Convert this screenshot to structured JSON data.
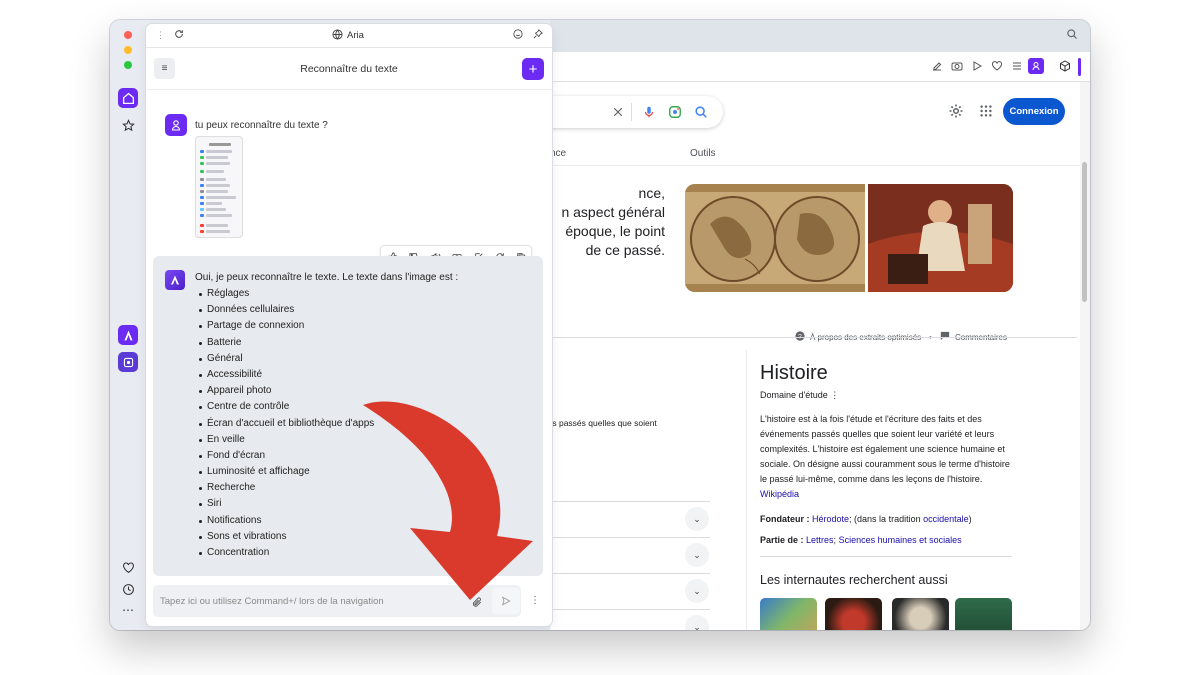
{
  "panel": {
    "top_title": "Aria",
    "header_title": "Reconnaître du texte",
    "user_message": "tu peux reconnaître du texte ?",
    "answer_intro": "Oui, je peux reconnaître le texte. Le texte dans l'image est :",
    "answer_items": [
      "Réglages",
      "Données cellulaires",
      "Partage de connexion",
      "Batterie",
      "Général",
      "Accessibilité",
      "Appareil photo",
      "Centre de contrôle",
      "Écran d'accueil et bibliothèque d'apps",
      "En veille",
      "Fond d'écran",
      "Luminosité et affichage",
      "Recherche",
      "Siri",
      "Notifications",
      "Sons et vibrations",
      "Concentration"
    ],
    "input_placeholder": "Tapez ici ou utilisez Command+/ lors de la navigation"
  },
  "web": {
    "connexion_label": "Connexion",
    "nav_partial": "nce",
    "nav_tools": "Outils",
    "snippet_lines": [
      "nce,",
      "n aspect général",
      "époque, le point",
      "de ce passé."
    ],
    "about_label": "À propos des extraits optimisés",
    "comments_label": "Commentaires",
    "left_snippet": "ts passés quelles que soient",
    "kp": {
      "title": "Histoire",
      "subtitle": "Domaine d'étude",
      "description": "L'histoire est à la fois l'étude et l'écriture des faits et des événements passés quelles que soient leur variété et leurs complexités. L'histoire est également une science humaine et sociale. On désigne aussi couramment sous le terme d'histoire le passé lui-même, comme dans les leçons de l'histoire.",
      "wiki_link": "Wikipédia",
      "fondateur_label": "Fondateur :",
      "fondateur_link": "Hérodote",
      "fondateur_rest_1": "; (dans la tradition ",
      "fondateur_link2": "occidentale",
      "fondateur_rest_2": ")",
      "partie_label": "Partie de :",
      "partie_link1": "Lettres",
      "partie_sep": "; ",
      "partie_link2": "Sciences humaines et sociales",
      "people_also": "Les internautes recherchent aussi"
    }
  },
  "colors": {
    "accent": "#6c2bf2",
    "google_blue": "#0b57d0",
    "arrow_red": "#d93a2c"
  }
}
